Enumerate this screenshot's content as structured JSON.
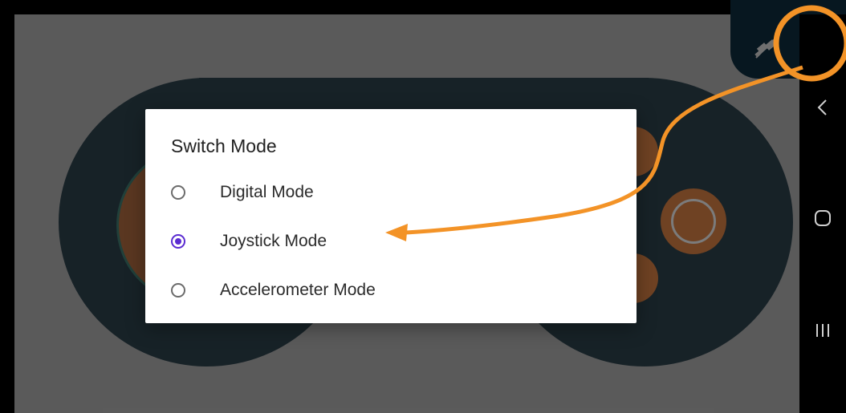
{
  "dialog": {
    "title": "Switch Mode",
    "options": [
      {
        "label": "Digital Mode",
        "selected": false
      },
      {
        "label": "Joystick Mode",
        "selected": true
      },
      {
        "label": "Accelerometer Mode",
        "selected": false
      }
    ]
  },
  "top_bar": {
    "icons": [
      "plug-disconnect-icon",
      "switch-mode-icon"
    ]
  },
  "nav_bar": {
    "buttons": [
      "back-icon",
      "home-icon",
      "recents-icon"
    ]
  },
  "colors": {
    "accent_radio": "#5a2bd1",
    "annotation": "#f39327",
    "gamepad_body": "#04141d",
    "button_orange": "#8a4516"
  }
}
